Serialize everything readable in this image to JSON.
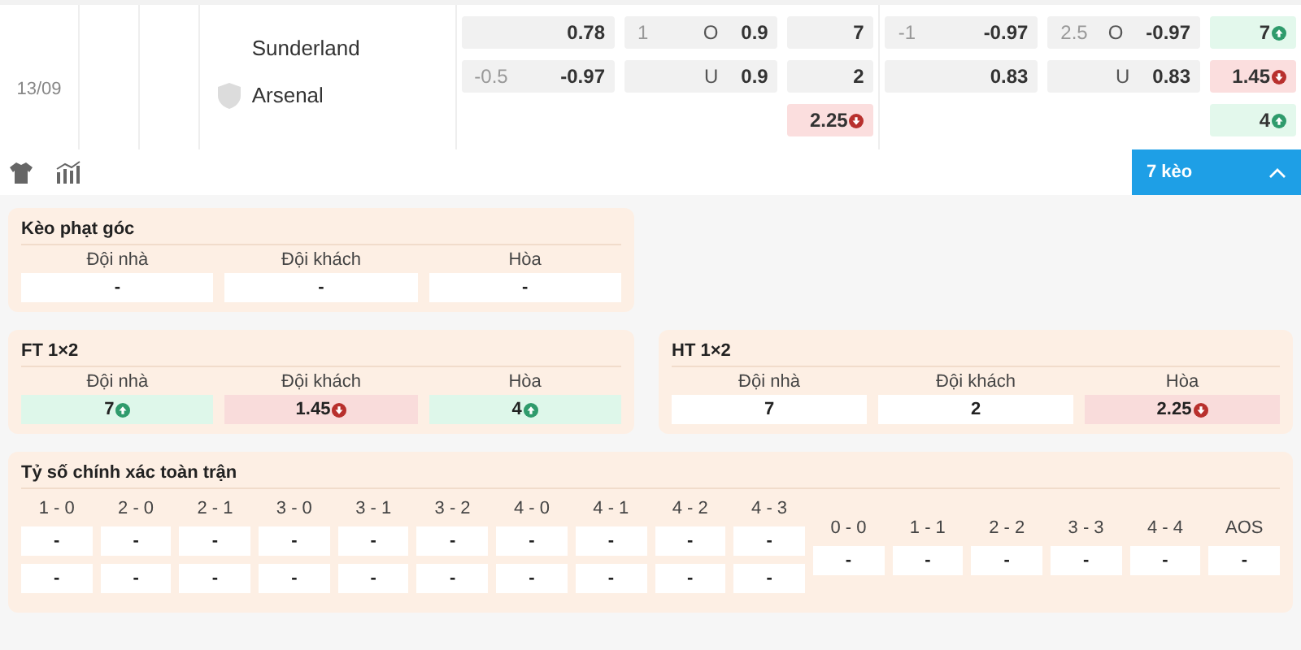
{
  "match": {
    "date": "13/09",
    "home_team": "Sunderland",
    "away_team": "Arsenal",
    "odds_groups": [
      {
        "columns": [
          {
            "cells": [
              {
                "odds": "0.78",
                "rising": false,
                "falling": false
              },
              {
                "line": "-0.5",
                "odds": "-0.97",
                "rising": false,
                "falling": false
              }
            ]
          },
          {
            "cells": [
              {
                "line": "1",
                "side": "O",
                "odds": "0.9",
                "rising": false,
                "falling": false
              },
              {
                "side": "U",
                "odds": "0.9",
                "rising": false,
                "falling": false
              }
            ]
          },
          {
            "cells": [
              {
                "odds": "7",
                "rising": false,
                "falling": false
              },
              {
                "odds": "2",
                "rising": false,
                "falling": false
              },
              {
                "odds": "2.25",
                "rising": false,
                "falling": true
              }
            ]
          }
        ]
      },
      {
        "columns": [
          {
            "cells": [
              {
                "line": "-1",
                "odds": "-0.97",
                "rising": false,
                "falling": false
              },
              {
                "odds": "0.83",
                "rising": false,
                "falling": false
              }
            ]
          },
          {
            "cells": [
              {
                "line": "2.5",
                "side": "O",
                "odds": "-0.97",
                "rising": false,
                "falling": false
              },
              {
                "side": "U",
                "odds": "0.83",
                "rising": false,
                "falling": false
              }
            ]
          },
          {
            "cells": [
              {
                "odds": "7",
                "rising": true,
                "falling": false
              },
              {
                "odds": "1.45",
                "rising": false,
                "falling": true
              },
              {
                "odds": "4",
                "rising": true,
                "falling": false
              }
            ]
          }
        ]
      }
    ]
  },
  "toolbar": {
    "markets_button": {
      "label": "7 kèo",
      "expanded": true
    }
  },
  "markets": [
    {
      "title": "Kèo phạt góc",
      "columns": [
        {
          "label": "Đội nhà",
          "odds": "-",
          "rising": false,
          "falling": false
        },
        {
          "label": "Đội khách",
          "odds": "-",
          "rising": false,
          "falling": false
        },
        {
          "label": "Hòa",
          "odds": "-",
          "rising": false,
          "falling": false
        }
      ]
    },
    {
      "title": "FT 1×2",
      "columns": [
        {
          "label": "Đội nhà",
          "odds": "7",
          "rising": true,
          "falling": false
        },
        {
          "label": "Đội khách",
          "odds": "1.45",
          "rising": false,
          "falling": true
        },
        {
          "label": "Hòa",
          "odds": "4",
          "rising": true,
          "falling": false
        }
      ]
    },
    {
      "title": "HT 1×2",
      "columns": [
        {
          "label": "Đội nhà",
          "odds": "7",
          "rising": false,
          "falling": false
        },
        {
          "label": "Đội khách",
          "odds": "2",
          "rising": false,
          "falling": false
        },
        {
          "label": "Hòa",
          "odds": "2.25",
          "rising": false,
          "falling": true
        }
      ]
    }
  ],
  "correct_score": {
    "title": "Tỷ số chính xác toàn trận",
    "columns": [
      {
        "label": "1 - 0",
        "values": [
          "-",
          "-"
        ]
      },
      {
        "label": "2 - 0",
        "values": [
          "-",
          "-"
        ]
      },
      {
        "label": "2 - 1",
        "values": [
          "-",
          "-"
        ]
      },
      {
        "label": "3 - 0",
        "values": [
          "-",
          "-"
        ]
      },
      {
        "label": "3 - 1",
        "values": [
          "-",
          "-"
        ]
      },
      {
        "label": "3 - 2",
        "values": [
          "-",
          "-"
        ]
      },
      {
        "label": "4 - 0",
        "values": [
          "-",
          "-"
        ]
      },
      {
        "label": "4 - 1",
        "values": [
          "-",
          "-"
        ]
      },
      {
        "label": "4 - 2",
        "values": [
          "-",
          "-"
        ]
      },
      {
        "label": "4 - 3",
        "values": [
          "-",
          "-"
        ]
      },
      {
        "label": "0 - 0",
        "values": [
          "-"
        ]
      },
      {
        "label": "1 - 1",
        "values": [
          "-"
        ]
      },
      {
        "label": "2 - 2",
        "values": [
          "-"
        ]
      },
      {
        "label": "3 - 3",
        "values": [
          "-"
        ]
      },
      {
        "label": "4 - 4",
        "values": [
          "-"
        ]
      },
      {
        "label": "AOS",
        "values": [
          "-"
        ]
      }
    ]
  }
}
